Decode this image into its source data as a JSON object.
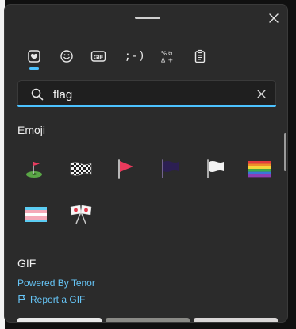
{
  "tabs": [
    {
      "name": "favorites",
      "icon": "heart-icon",
      "selected": true
    },
    {
      "name": "emoji",
      "icon": "smiley-icon"
    },
    {
      "name": "gif",
      "label": "GIF",
      "icon": "gif-icon"
    },
    {
      "name": "kaomoji",
      "label": ";-)",
      "icon": "kaomoji-icon"
    },
    {
      "name": "symbols",
      "icon": "symbols-icon"
    },
    {
      "name": "clipboard",
      "icon": "clipboard-icon"
    }
  ],
  "search": {
    "value": "flag"
  },
  "emoji_section": {
    "label": "Emoji",
    "items": [
      {
        "glyph": "⛳",
        "name": "flag-in-hole"
      },
      {
        "glyph": "🏁",
        "name": "chequered-flag"
      },
      {
        "glyph": "🚩",
        "name": "triangular-flag"
      },
      {
        "glyph": "🏴",
        "name": "black-flag"
      },
      {
        "glyph": "🏳️",
        "name": "white-flag"
      },
      {
        "glyph": "🏳️‍🌈",
        "name": "rainbow-flag"
      },
      {
        "glyph": "🏳️‍⚧️",
        "name": "transgender-flag"
      },
      {
        "glyph": "🎌",
        "name": "crossed-flags"
      }
    ]
  },
  "gif_section": {
    "label": "GIF",
    "powered_by": "Powered By Tenor",
    "report": "Report a GIF"
  },
  "colors": {
    "accent": "#4cc2ff",
    "panel_bg": "#2b2b2b",
    "link": "#66c4f5"
  }
}
